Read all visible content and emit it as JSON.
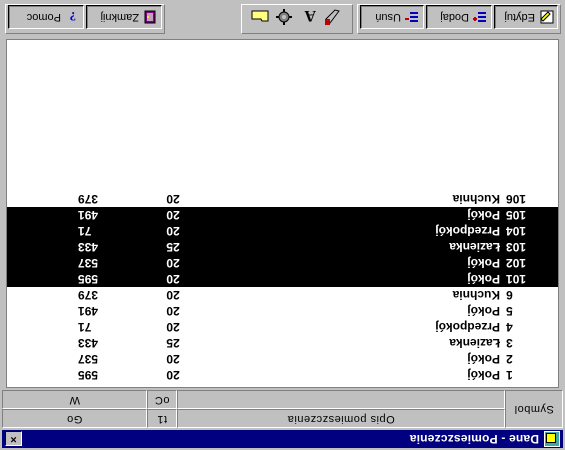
{
  "window": {
    "title": "Dane - Pomieszczenia",
    "close_label": "×"
  },
  "header": {
    "col_symbol": "Symbol",
    "col_opis": "Opis pomieszczenia",
    "col_temp_top": "t1",
    "col_temp_bottom": "oC",
    "col_vol_top": "Go",
    "col_vol_bottom": "W"
  },
  "rows": [
    {
      "num": "1",
      "name": "Pokój",
      "t": "20",
      "v": "595",
      "selected": false
    },
    {
      "num": "2",
      "name": "Pokój",
      "t": "20",
      "v": "537",
      "selected": false
    },
    {
      "num": "3",
      "name": "Łazienka",
      "t": "25",
      "v": "433",
      "selected": false
    },
    {
      "num": "4",
      "name": "Przedpokój",
      "t": "20",
      "v": "71",
      "selected": false
    },
    {
      "num": "5",
      "name": "Pokój",
      "t": "20",
      "v": "491",
      "selected": false
    },
    {
      "num": "6",
      "name": "Kuchnia",
      "t": "20",
      "v": "379",
      "selected": false
    },
    {
      "num": "101",
      "name": "Pokój",
      "t": "20",
      "v": "595",
      "selected": true
    },
    {
      "num": "102",
      "name": "Pokój",
      "t": "20",
      "v": "537",
      "selected": true
    },
    {
      "num": "103",
      "name": "Łazienka",
      "t": "25",
      "v": "433",
      "selected": true
    },
    {
      "num": "104",
      "name": "Przedpokój",
      "t": "20",
      "v": "71",
      "selected": true
    },
    {
      "num": "105",
      "name": "Pokój",
      "t": "20",
      "v": "491",
      "selected": true
    },
    {
      "num": "106",
      "name": "Kuchnia",
      "t": "20",
      "v": "379",
      "selected": false,
      "focused": true
    }
  ],
  "toolbar": {
    "edit_label": "Edytuj",
    "add_label": "Dodaj",
    "delete_label": "Usuń",
    "close_label": "Zamknij",
    "help_label": "Pomoc"
  },
  "colors": {
    "titlebar": "#000080",
    "selection": "#000000",
    "face": "#c0c0c0"
  }
}
